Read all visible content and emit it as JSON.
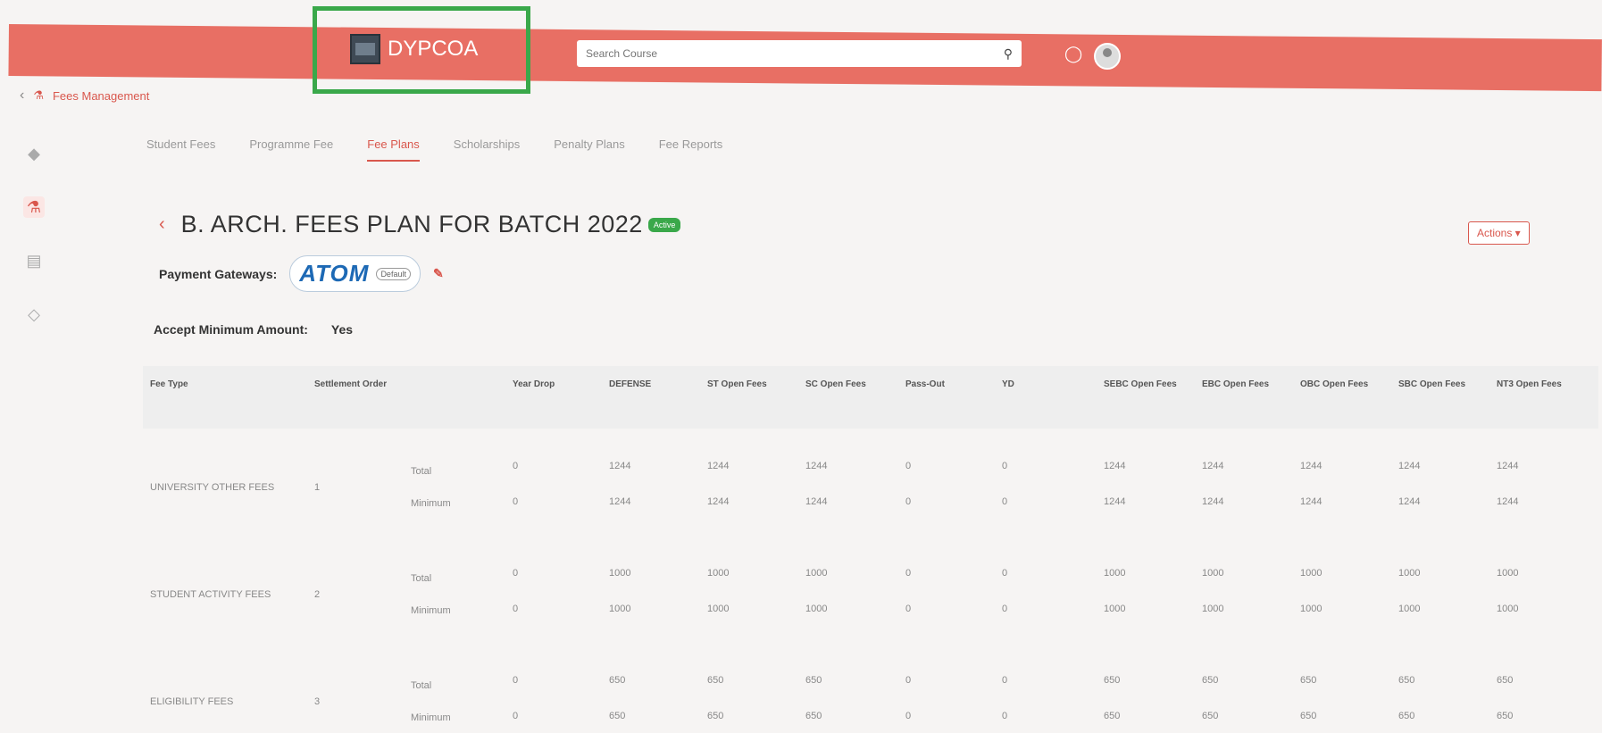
{
  "header": {
    "brand": "DYPCOA",
    "search_placeholder": "Search Course",
    "search_icon": "search-icon",
    "bell_icon": "bell-icon",
    "avatar_icon": "avatar-icon"
  },
  "breadcrumb": {
    "label": "Fees Management"
  },
  "tabs": [
    {
      "label": "Student Fees"
    },
    {
      "label": "Programme Fee"
    },
    {
      "label": "Fee Plans"
    },
    {
      "label": "Scholarships"
    },
    {
      "label": "Penalty Plans"
    },
    {
      "label": "Fee Reports"
    }
  ],
  "plan": {
    "title": "B. ARCH. FEES PLAN FOR BATCH 2022",
    "badge": "Active",
    "actions_label": "Actions ▾",
    "payment_gateways_label": "Payment Gateways:",
    "gateway_name": "ATOM",
    "gateway_default": "Default",
    "accept_min_label": "Accept Minimum Amount:",
    "accept_min_value": "Yes"
  },
  "table": {
    "headers": [
      "Fee Type",
      "Settlement Order",
      "",
      "Year Drop",
      "DEFENSE",
      "ST Open Fees",
      "SC Open Fees",
      "Pass-Out",
      "YD",
      "SEBC Open Fees",
      "EBC Open Fees",
      "OBC Open Fees",
      "SBC Open Fees",
      "NT3 Open Fees"
    ],
    "rows": [
      {
        "fee_type": "UNIVERSITY OTHER FEES",
        "order": "1",
        "total_label": "Total",
        "min_label": "Minimum",
        "total": [
          "0",
          "1244",
          "1244",
          "1244",
          "0",
          "0",
          "1244",
          "1244",
          "1244",
          "1244",
          "1244"
        ],
        "minimum": [
          "0",
          "1244",
          "1244",
          "1244",
          "0",
          "0",
          "1244",
          "1244",
          "1244",
          "1244",
          "1244"
        ]
      },
      {
        "fee_type": "STUDENT ACTIVITY FEES",
        "order": "2",
        "total_label": "Total",
        "min_label": "Minimum",
        "total": [
          "0",
          "1000",
          "1000",
          "1000",
          "0",
          "0",
          "1000",
          "1000",
          "1000",
          "1000",
          "1000"
        ],
        "minimum": [
          "0",
          "1000",
          "1000",
          "1000",
          "0",
          "0",
          "1000",
          "1000",
          "1000",
          "1000",
          "1000"
        ]
      },
      {
        "fee_type": "ELIGIBILITY FEES",
        "order": "3",
        "total_label": "Total",
        "min_label": "Minimum",
        "total": [
          "0",
          "650",
          "650",
          "650",
          "0",
          "0",
          "650",
          "650",
          "650",
          "650",
          "650"
        ],
        "minimum": [
          "0",
          "650",
          "650",
          "650",
          "0",
          "0",
          "650",
          "650",
          "650",
          "650",
          "650"
        ]
      }
    ]
  },
  "colors": {
    "header": "#e86f64",
    "accent": "#d9574d",
    "highlight_box": "#3aa84a"
  }
}
